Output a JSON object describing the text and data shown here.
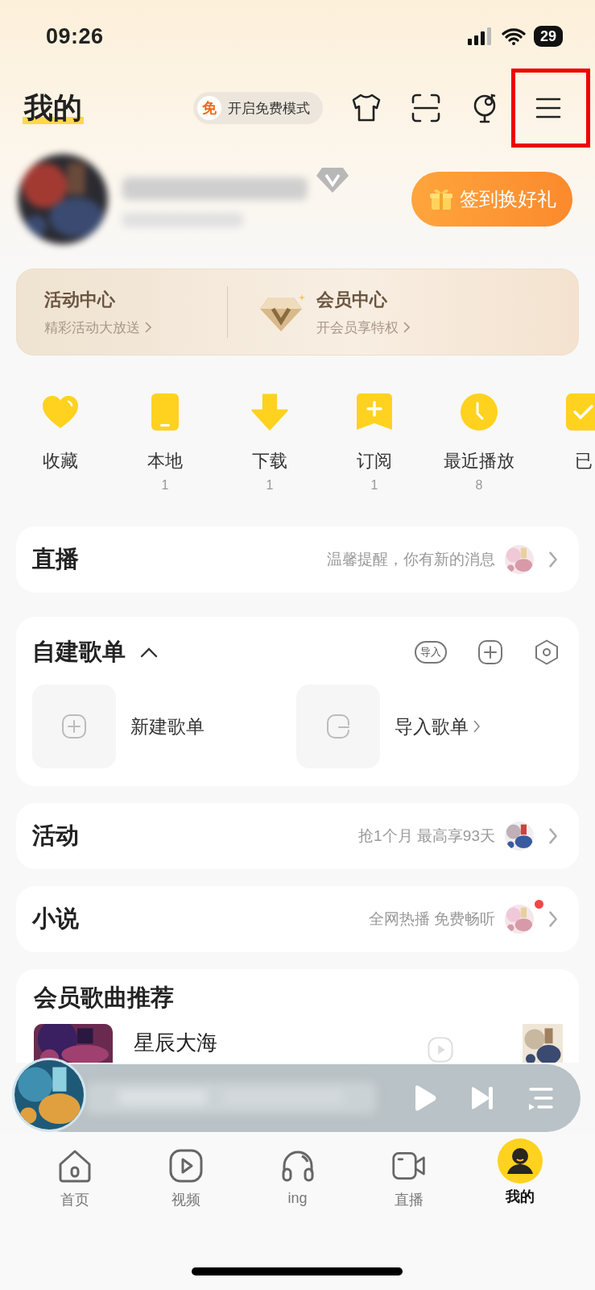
{
  "status_bar": {
    "time": "09:26",
    "battery": "29"
  },
  "header": {
    "title": "我的",
    "free_mode": {
      "badge": "免",
      "label": "开启免费模式"
    },
    "menu_highlighted": true
  },
  "profile": {
    "checkin_button": "签到换好礼"
  },
  "member_card": [
    {
      "kind": "plain",
      "title": "活动中心",
      "subtitle": "精彩活动大放送"
    },
    {
      "kind": "diamond",
      "title": "会员中心",
      "subtitle": "开会员享特权"
    }
  ],
  "shortcuts": [
    {
      "kind": "heart",
      "label": "收藏"
    },
    {
      "kind": "phone",
      "label": "本地",
      "count": "1"
    },
    {
      "kind": "download",
      "label": "下载",
      "count": "1"
    },
    {
      "kind": "bookmark",
      "label": "订阅",
      "count": "1"
    },
    {
      "kind": "clock",
      "label": "最近播放",
      "count": "8"
    },
    {
      "kind": "check",
      "label": "已"
    }
  ],
  "sections": [
    {
      "kind": "row",
      "title": "直播",
      "hint": "温馨提醒，你有新的消息",
      "dot": false
    },
    {
      "kind": "playlists",
      "title": "自建歌单",
      "expanded": true,
      "import_badge": "导入",
      "items": [
        {
          "kind": "new",
          "label": "新建歌单",
          "chevron": false
        },
        {
          "kind": "import",
          "label": "导入歌单",
          "chevron": true
        }
      ]
    },
    {
      "kind": "row",
      "title": "活动",
      "hint": "抢1个月 最高享93天",
      "dot": false
    },
    {
      "kind": "row",
      "title": "小说",
      "hint": "全网热播 免费畅听",
      "dot": true
    }
  ],
  "recommend": {
    "title": "会员歌曲推荐",
    "songs": [
      {
        "title": "星辰大海"
      }
    ]
  },
  "player": {
    "playing": false
  },
  "tabs": [
    {
      "kind": "home",
      "label": "首页",
      "selected": false
    },
    {
      "kind": "video",
      "label": "视频",
      "selected": false
    },
    {
      "kind": "headphones",
      "label": "ing",
      "selected": false
    },
    {
      "kind": "camera",
      "label": "直播",
      "selected": false
    },
    {
      "kind": "me",
      "label": "我的",
      "selected": true
    }
  ]
}
